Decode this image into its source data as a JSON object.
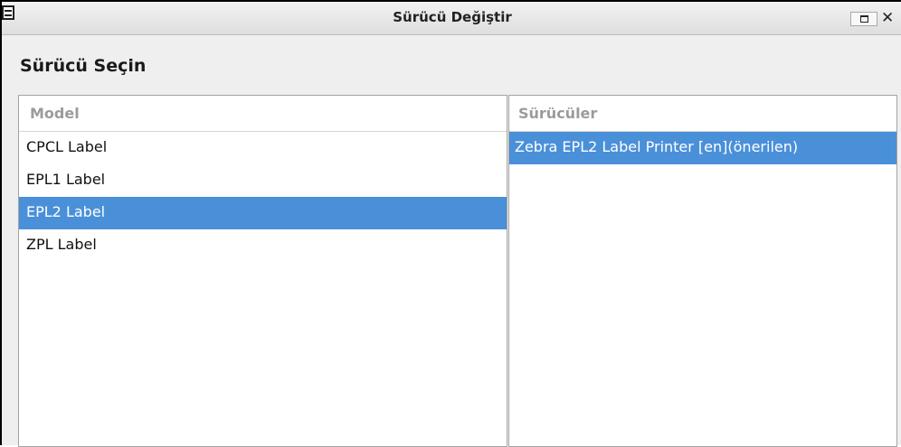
{
  "window": {
    "title": "Sürücü Değiştir",
    "close_glyph": "✕"
  },
  "heading": "Sürücü Seçin",
  "model_list": {
    "header": "Model",
    "items": [
      {
        "label": "CPCL Label",
        "selected": false
      },
      {
        "label": "EPL1 Label",
        "selected": false
      },
      {
        "label": "EPL2 Label",
        "selected": true
      },
      {
        "label": "ZPL Label",
        "selected": false
      }
    ]
  },
  "driver_list": {
    "header": "Sürücüler",
    "items": [
      {
        "label": "Zebra EPL2 Label Printer [en](önerilen)",
        "selected": true
      }
    ]
  },
  "colors": {
    "selection": "#4a90d9",
    "header_text": "#9b9b9b"
  },
  "icons": {
    "app": "printer-dialog-icon",
    "maximize": "maximize-icon",
    "close": "close-icon"
  }
}
